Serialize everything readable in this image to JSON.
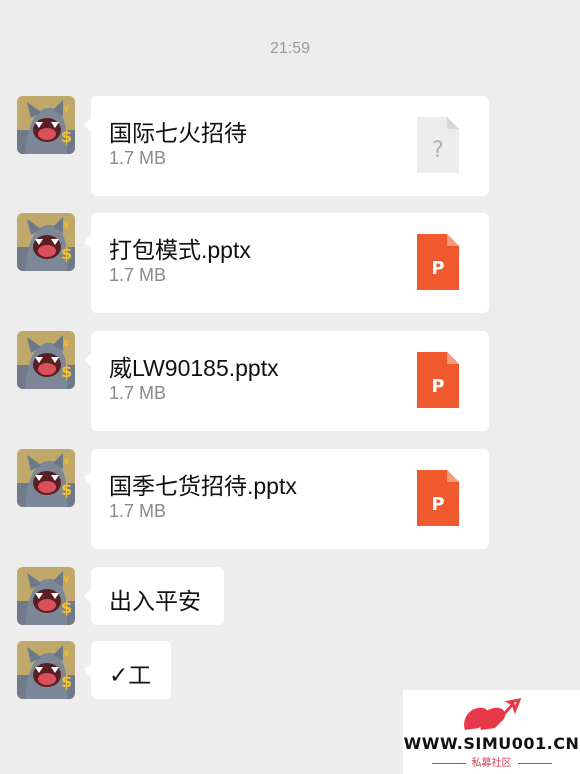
{
  "chat": {
    "timestamp": "21:59",
    "messages": [
      {
        "type": "file",
        "name": "国际七火招待",
        "size": "1.7 MB",
        "icon": "unknown-file-icon"
      },
      {
        "type": "file",
        "name": "打包模式.pptx",
        "size": "1.7 MB",
        "icon": "pptx-file-icon"
      },
      {
        "type": "file",
        "name": "威LW90185.pptx",
        "size": "1.7 MB",
        "icon": "pptx-file-icon"
      },
      {
        "type": "file",
        "name": "国季七货招待.pptx",
        "size": "1.7 MB",
        "icon": "pptx-file-icon"
      },
      {
        "type": "text",
        "text": "出入平安"
      },
      {
        "type": "text",
        "text": "✓工"
      }
    ]
  },
  "watermark": {
    "site": "WWW.SIMU001.CN",
    "subtitle": "私募社区"
  },
  "colors": {
    "background": "#ededed",
    "bubble": "#ffffff",
    "pptx": "#f0592e",
    "unknown_file": "#ececec"
  }
}
